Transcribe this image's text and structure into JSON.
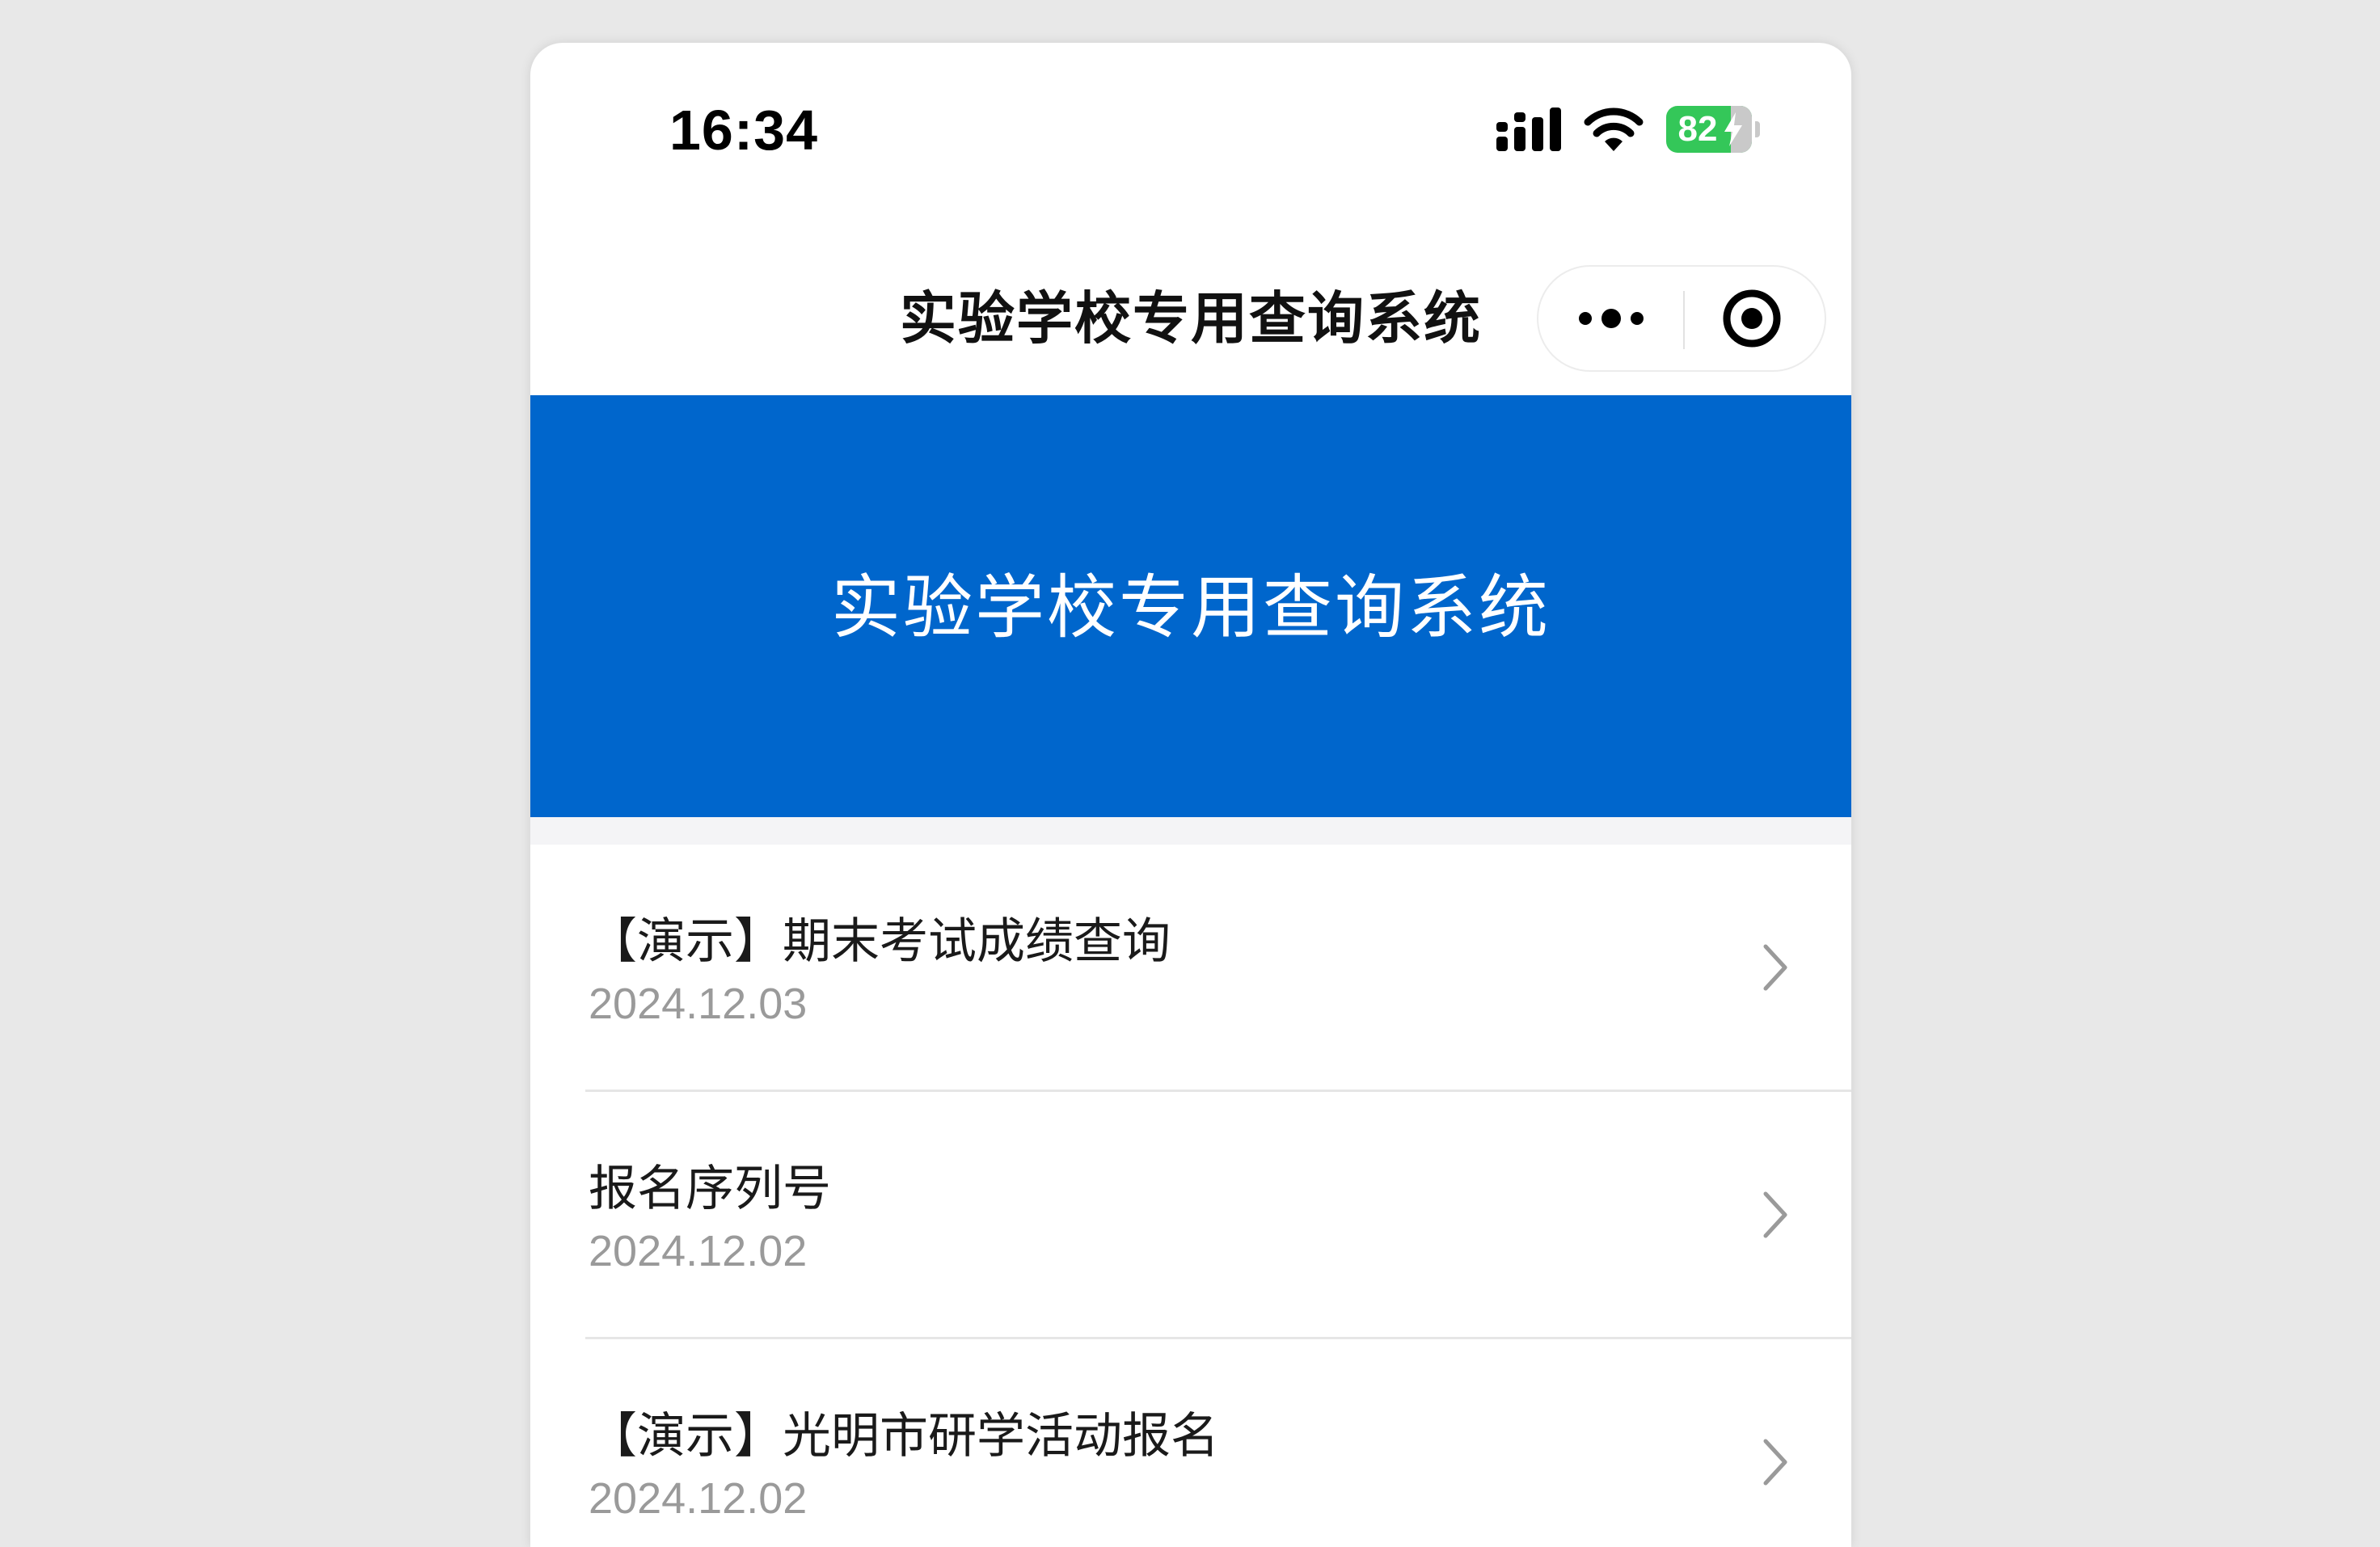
{
  "status_bar": {
    "time": "16:34",
    "battery_level": "82",
    "battery_color": "#34c759",
    "icons": [
      "signal-icon",
      "wifi-icon",
      "battery-icon",
      "bolt-icon"
    ]
  },
  "nav": {
    "title": "实验学校专用查询系统",
    "more_icon": "more-dots-icon",
    "close_icon": "target-circle-icon"
  },
  "banner": {
    "title": "实验学校专用查询系统",
    "background_color": "#0066cc"
  },
  "list": {
    "items": [
      {
        "title": "【演示】期末考试成绩查询",
        "date": "2024.12.03"
      },
      {
        "title": "报名序列号",
        "date": "2024.12.02"
      },
      {
        "title": "【演示】光明市研学活动报名",
        "date": "2024.12.02"
      }
    ],
    "chevron_icon": "chevron-right-icon"
  }
}
